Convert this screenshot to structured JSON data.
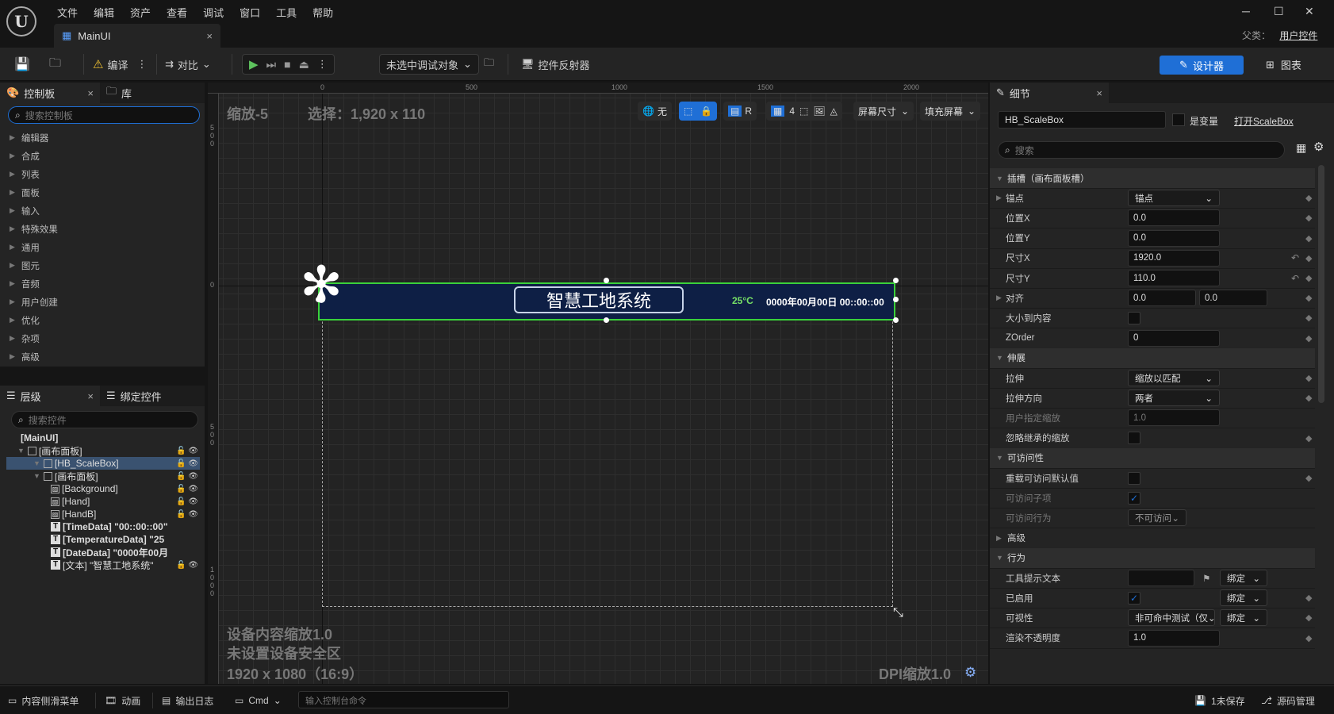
{
  "menu": [
    "文件",
    "编辑",
    "资产",
    "查看",
    "调试",
    "窗口",
    "工具",
    "帮助"
  ],
  "window_controls": {
    "minimize": "─",
    "maximize": "☐",
    "close": "✕"
  },
  "parent_class": {
    "label": "父类：",
    "value": "用户控件"
  },
  "doc_tab": {
    "title": "MainUI",
    "close": "×"
  },
  "toolbar": {
    "compile": "编译",
    "diff": "对比",
    "debug_target": "未选中调试对象",
    "widget_reflector": "控件反射器",
    "designer": "设计器",
    "graph": "图表"
  },
  "palette": {
    "tab_label": "控制板",
    "library_tab": "库",
    "search_placeholder": "搜索控制板",
    "categories": [
      "编辑器",
      "合成",
      "列表",
      "面板",
      "输入",
      "特殊效果",
      "通用",
      "图元",
      "音频",
      "用户创建",
      "优化",
      "杂项",
      "高级"
    ]
  },
  "hierarchy": {
    "tab_label": "层级",
    "bind_tab": "绑定控件",
    "search_placeholder": "搜索控件",
    "items": [
      {
        "label": "[MainUI]",
        "bold": true
      },
      {
        "label": "[画布面板]"
      },
      {
        "label": "[HB_ScaleBox]",
        "selected": true
      },
      {
        "label": "[画布面板]"
      },
      {
        "label": "[Background]"
      },
      {
        "label": "[Hand]"
      },
      {
        "label": "[HandB]"
      },
      {
        "label": "[TimeData] \"00::00::00\"",
        "bold": true
      },
      {
        "label": "[TemperatureData] \"25",
        "bold": true
      },
      {
        "label": "[DateData] \"0000年00月",
        "bold": true
      },
      {
        "label": "[文本] \"智慧工地系统\""
      }
    ]
  },
  "canvas": {
    "zoom": "缩放-5",
    "selection": "选择：1,920 x 110",
    "none_label": "无",
    "r_label": "R",
    "grid_num": "4",
    "screen_size": "屏幕尺寸",
    "fill_screen": "填充屏幕",
    "ruler_top": [
      "0",
      "500",
      "1000",
      "1500",
      "2000"
    ],
    "ruler_left": [
      "5 0 0",
      "0",
      "5 0 0",
      "1 0 0 0"
    ],
    "device_scale": "设备内容缩放1.0",
    "safe_zone": "未设置设备安全区",
    "resolution": "1920 x 1080（16:9）",
    "dpi": "DPI缩放1.0",
    "banner_title": "智慧工地系统",
    "temperature": "25°C",
    "datetime": "0000年00月00日  00::00::00"
  },
  "details": {
    "tab_label": "细节",
    "name": "HB_ScaleBox",
    "is_variable": "是变量",
    "open_link": "打开ScaleBox",
    "search_placeholder": "搜索",
    "rows": [
      {
        "type": "section",
        "label": "插槽（画布面板槽）"
      },
      {
        "type": "drop",
        "label": "锚点",
        "value": "锚点",
        "expand": true
      },
      {
        "type": "val",
        "label": "位置X",
        "value": "0.0"
      },
      {
        "type": "val",
        "label": "位置Y",
        "value": "0.0"
      },
      {
        "type": "val",
        "label": "尺寸X",
        "value": "1920.0",
        "reset": true
      },
      {
        "type": "val",
        "label": "尺寸Y",
        "value": "110.0",
        "reset": true
      },
      {
        "type": "val2",
        "label": "对齐",
        "value": "0.0",
        "value2": "0.0",
        "expand": true
      },
      {
        "type": "chk",
        "label": "大小到内容"
      },
      {
        "type": "val",
        "label": "ZOrder",
        "value": "0"
      },
      {
        "type": "section",
        "label": "伸展"
      },
      {
        "type": "drop",
        "label": "拉伸",
        "value": "缩放以匹配"
      },
      {
        "type": "drop",
        "label": "拉伸方向",
        "value": "两者"
      },
      {
        "type": "val",
        "label": "用户指定缩放",
        "value": "1.0",
        "dim": true
      },
      {
        "type": "chk",
        "label": "忽略继承的缩放"
      },
      {
        "type": "section",
        "label": "可访问性"
      },
      {
        "type": "chk",
        "label": "重载可访问默认值"
      },
      {
        "type": "chk",
        "label": "可访问子项",
        "dim": true,
        "checked": true
      },
      {
        "type": "drop",
        "label": "可访问行为",
        "value": "不可访问",
        "dim": true
      },
      {
        "type": "subsection",
        "label": "高级"
      },
      {
        "type": "section",
        "label": "行为"
      },
      {
        "type": "tooltip",
        "label": "工具提示文本",
        "bind": "绑定"
      },
      {
        "type": "chkbind",
        "label": "已启用",
        "bind": "绑定",
        "checked": true
      },
      {
        "type": "dropbind",
        "label": "可视性",
        "value": "非可命中测试（仅",
        "bind": "绑定"
      },
      {
        "type": "val",
        "label": "渲染不透明度",
        "value": "1.0"
      }
    ]
  },
  "statusbar": {
    "drawer": "内容侧滑菜单",
    "anim": "动画",
    "log": "输出日志",
    "cmd": "Cmd",
    "cmd_placeholder": "输入控制台命令",
    "unsaved": "1未保存",
    "source": "源码管理"
  },
  "colors": {
    "accent": "#1f6fd6",
    "selection_green": "#3ad13a",
    "banner_bg": "#0e1f45",
    "play_green": "#5ec35e"
  }
}
